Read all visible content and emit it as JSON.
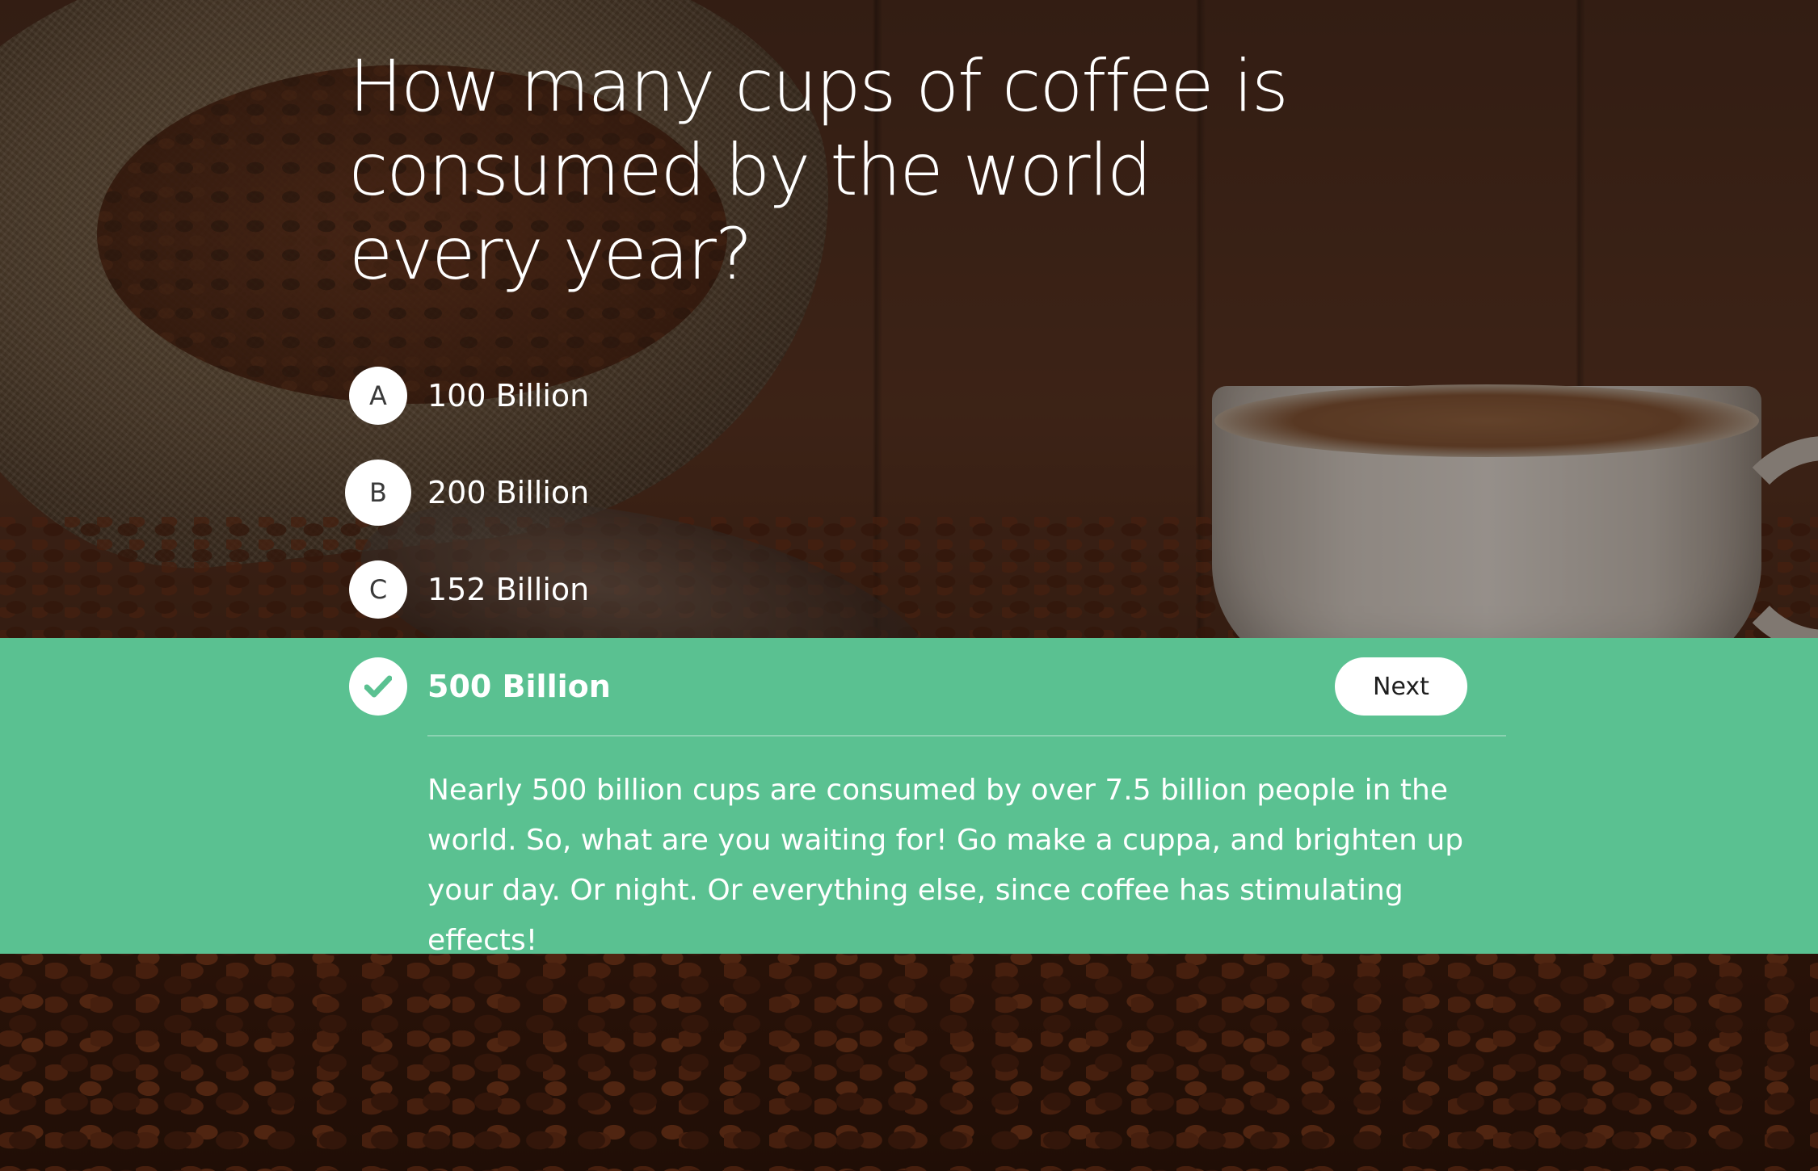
{
  "quiz": {
    "question": "How many cups of coffee is consumed by the world every year?",
    "options": [
      {
        "letter": "A",
        "label": "100 Billion"
      },
      {
        "letter": "B",
        "label": "200 Billion"
      },
      {
        "letter": "C",
        "label": "152 Billion"
      }
    ],
    "correct_answer": {
      "icon": "checkmark-icon",
      "label": "500 Billion"
    },
    "next_label": "Next",
    "explanation": "Nearly 500 billion cups are consumed by over 7.5 billion people in the world. So, what are you waiting for! Go make a cuppa, and brighten up your day. Or night. Or everything else, since coffee has stimulating effects!"
  },
  "colors": {
    "correct_panel": "#5ac191",
    "badge_bg": "#ffffff",
    "text": "#ffffff"
  },
  "background": {
    "image": "coffee-beans-sack-and-cup"
  }
}
